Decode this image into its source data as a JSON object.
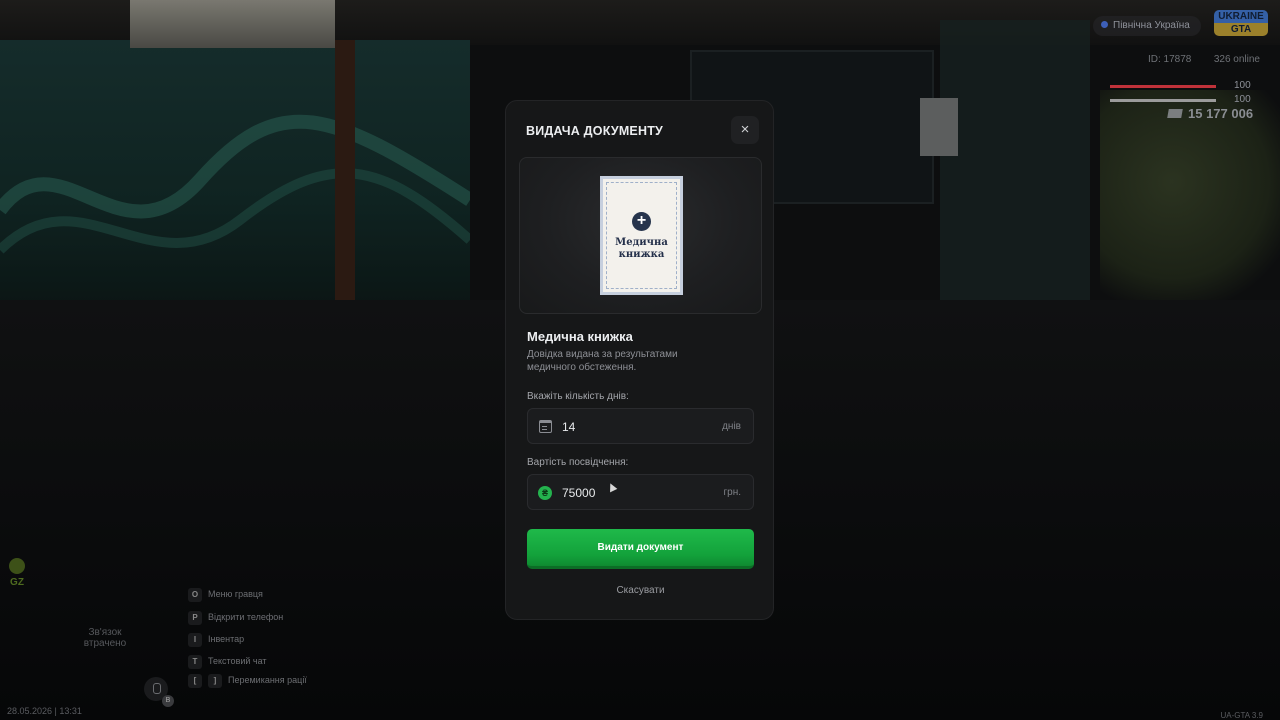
{
  "hud": {
    "server": "Північна Україна",
    "logo": "UKRAINE GTA",
    "player_id": "ID: 17878",
    "online": "326 online",
    "health_value": "100",
    "armor_value": "100",
    "health_level": 1.0,
    "armor_level": 1.0,
    "money": "15 177 006",
    "health_color": "#c0323a",
    "armor_color": "#9b9b9b"
  },
  "hints": [
    {
      "key": "O",
      "label": "Меню гравця"
    },
    {
      "key": "P",
      "label": "Відкрити телефон"
    },
    {
      "key": "I",
      "label": "Інвентар"
    },
    {
      "key": "T",
      "label": "Текстовий чат"
    },
    {
      "key": "[",
      "key2": "]",
      "label": "Перемикання рації"
    }
  ],
  "voice": {
    "status": "Зв'язок втрачено",
    "badge": "B"
  },
  "gz_label": "GZ",
  "datetime": "28.05.2026 | 13:31",
  "version": "UA-GTA 3.9",
  "modal": {
    "title": "ВИДАЧА ДОКУМЕНТУ",
    "close_icon": "×",
    "document_card_text": "Медична книжка",
    "document_name": "Медична книжка",
    "document_description": "Довідка видана за результатами медичного обстеження.",
    "days_label": "Вкажіть кількість днів:",
    "days_value": "14",
    "days_unit": "днів",
    "cost_label": "Вартість посвідчення:",
    "cost_value": "75000",
    "cost_unit": "грн.",
    "issue_button": "Видати документ",
    "cancel_button": "Скасувати",
    "accent_color": "#1fb94a"
  }
}
